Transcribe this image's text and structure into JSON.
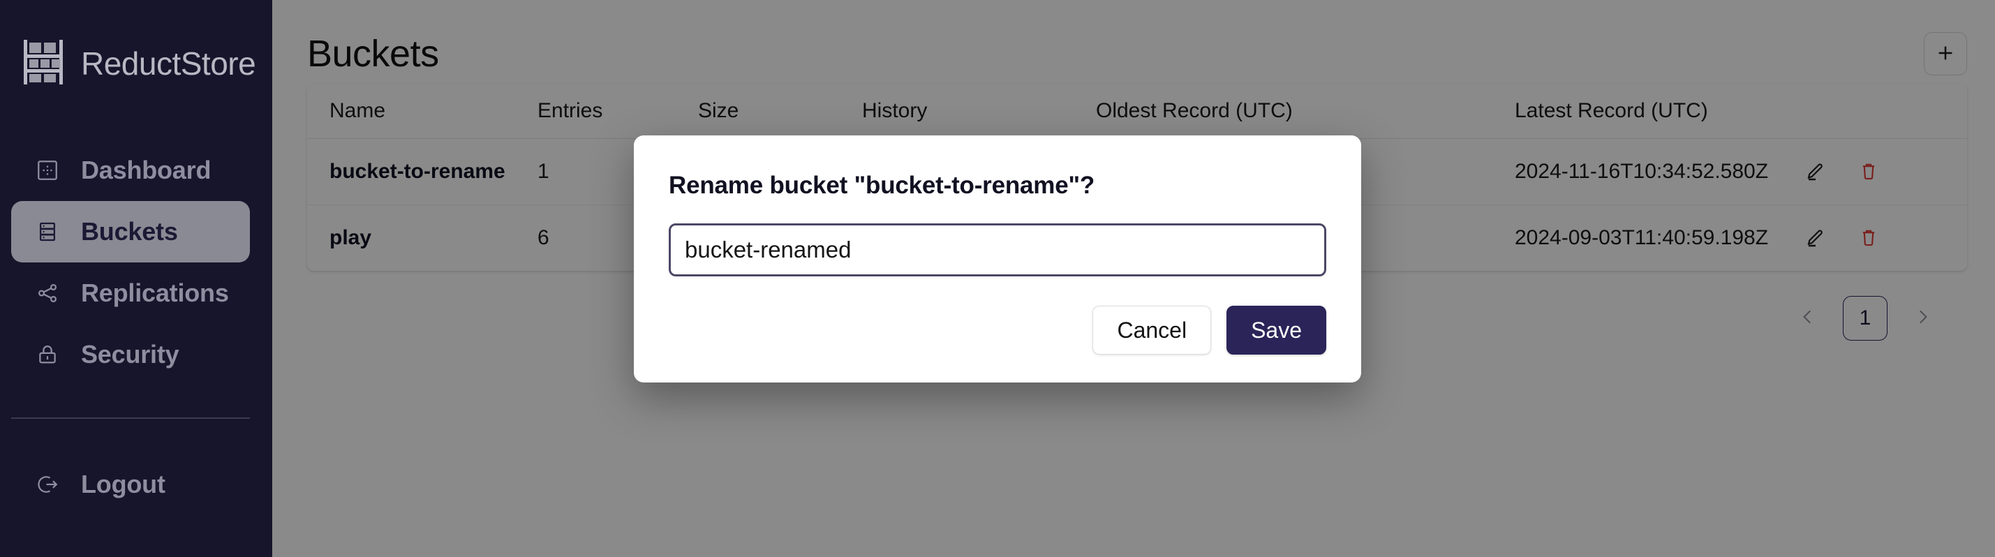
{
  "brand": {
    "name": "ReductStore",
    "logo_icon": "shelf-rack-logo-icon"
  },
  "sidebar": {
    "items": [
      {
        "label": "Dashboard",
        "icon": "dashboard-icon",
        "active": false
      },
      {
        "label": "Buckets",
        "icon": "database-icon",
        "active": true
      },
      {
        "label": "Replications",
        "icon": "share-nodes-icon",
        "active": false
      },
      {
        "label": "Security",
        "icon": "lock-icon",
        "active": false
      }
    ],
    "logout": {
      "label": "Logout",
      "icon": "logout-icon"
    }
  },
  "header": {
    "title": "Buckets",
    "add_button_icon": "plus-icon"
  },
  "table": {
    "columns": [
      "Name",
      "Entries",
      "Size",
      "History",
      "Oldest Record (UTC)",
      "Latest Record (UTC)"
    ],
    "rows": [
      {
        "name": "bucket-to-rename",
        "entries": "1",
        "size": "",
        "history": "",
        "oldest": "",
        "latest": "2024-11-16T10:34:52.580Z",
        "edit_icon": "pencil-icon",
        "delete_icon": "trash-icon"
      },
      {
        "name": "play",
        "entries": "6",
        "size": "",
        "history": "",
        "oldest": "",
        "latest": "2024-09-03T11:40:59.198Z",
        "edit_icon": "pencil-icon",
        "delete_icon": "trash-icon"
      }
    ]
  },
  "pagination": {
    "prev_icon": "chevron-left-icon",
    "next_icon": "chevron-right-icon",
    "current_page": "1"
  },
  "modal": {
    "title": "Rename bucket \"bucket-to-rename\"?",
    "input_value": "bucket-renamed",
    "input_placeholder": "",
    "cancel_label": "Cancel",
    "save_label": "Save"
  },
  "colors": {
    "sidebar_bg": "#17152b",
    "accent_dark": "#2b2459",
    "danger": "#e03a34",
    "overlay": "rgba(0,0,0,0.46)"
  }
}
